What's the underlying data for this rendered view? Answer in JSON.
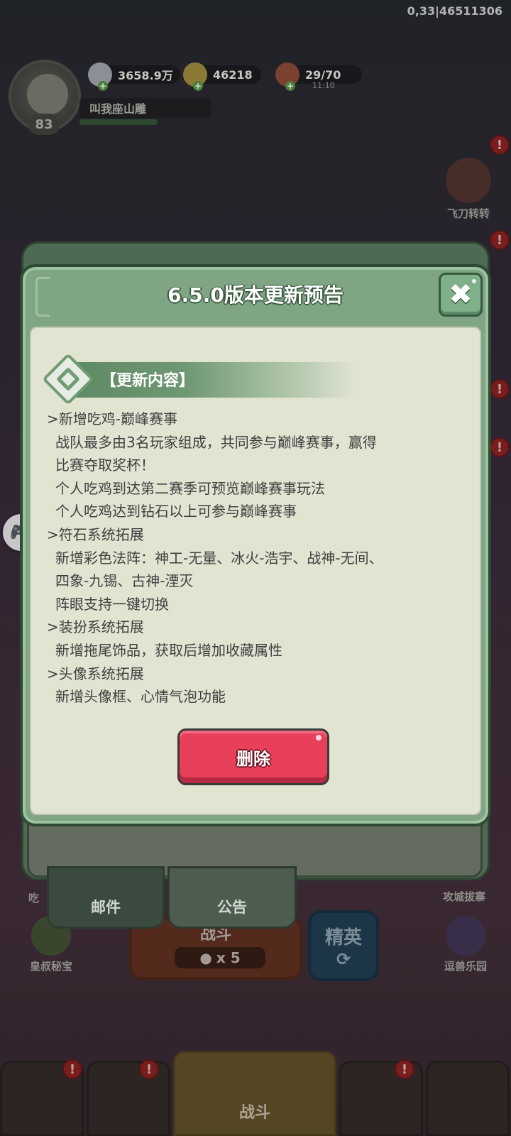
{
  "debug_code": "0,33|46511306",
  "player": {
    "level": "83",
    "name": "叫我座山雕",
    "silver": "3658.9万",
    "gold": "46218",
    "stamina": "29/70",
    "stamina_timer": "11:10"
  },
  "side_buttons": {
    "flying_knife": "飞刀转转",
    "eat": "吃",
    "siege": "攻城拔寨",
    "uncle_treasure": "皇叔秘宝",
    "beast_park": "逗兽乐园"
  },
  "bottom_tabs": {
    "mail": "邮件",
    "notice": "公告"
  },
  "battle": {
    "label": "战斗",
    "count": "x 5",
    "elite": "精英",
    "nav_center": "战斗"
  },
  "modal": {
    "title": "6.5.0版本更新预告",
    "section_title": "【更新内容】",
    "close_icon": "close-icon",
    "lines": [
      ">新增吃鸡-巅峰赛事",
      "战队最多由3名玩家组成，共同参与巅峰赛事，赢得",
      "比赛夺取奖杯！",
      "个人吃鸡到达第二赛季可预览巅峰赛事玩法",
      "个人吃鸡达到钻石以上可参与巅峰赛事",
      ">符石系统拓展",
      "新增彩色法阵：神工-无量、冰火-浩宇、战神-无间、",
      "四象-九锡、古神-湮灭",
      "阵眼支持一键切换",
      ">装扮系统拓展",
      "新增拖尾饰品，获取后增加收藏属性",
      ">头像系统拓展",
      "新增头像框、心情气泡功能"
    ],
    "delete_label": "删除"
  },
  "colors": {
    "modal_frame": "#7fa585",
    "content_bg": "#e2e4d2",
    "delete_button": "#e8405a"
  }
}
